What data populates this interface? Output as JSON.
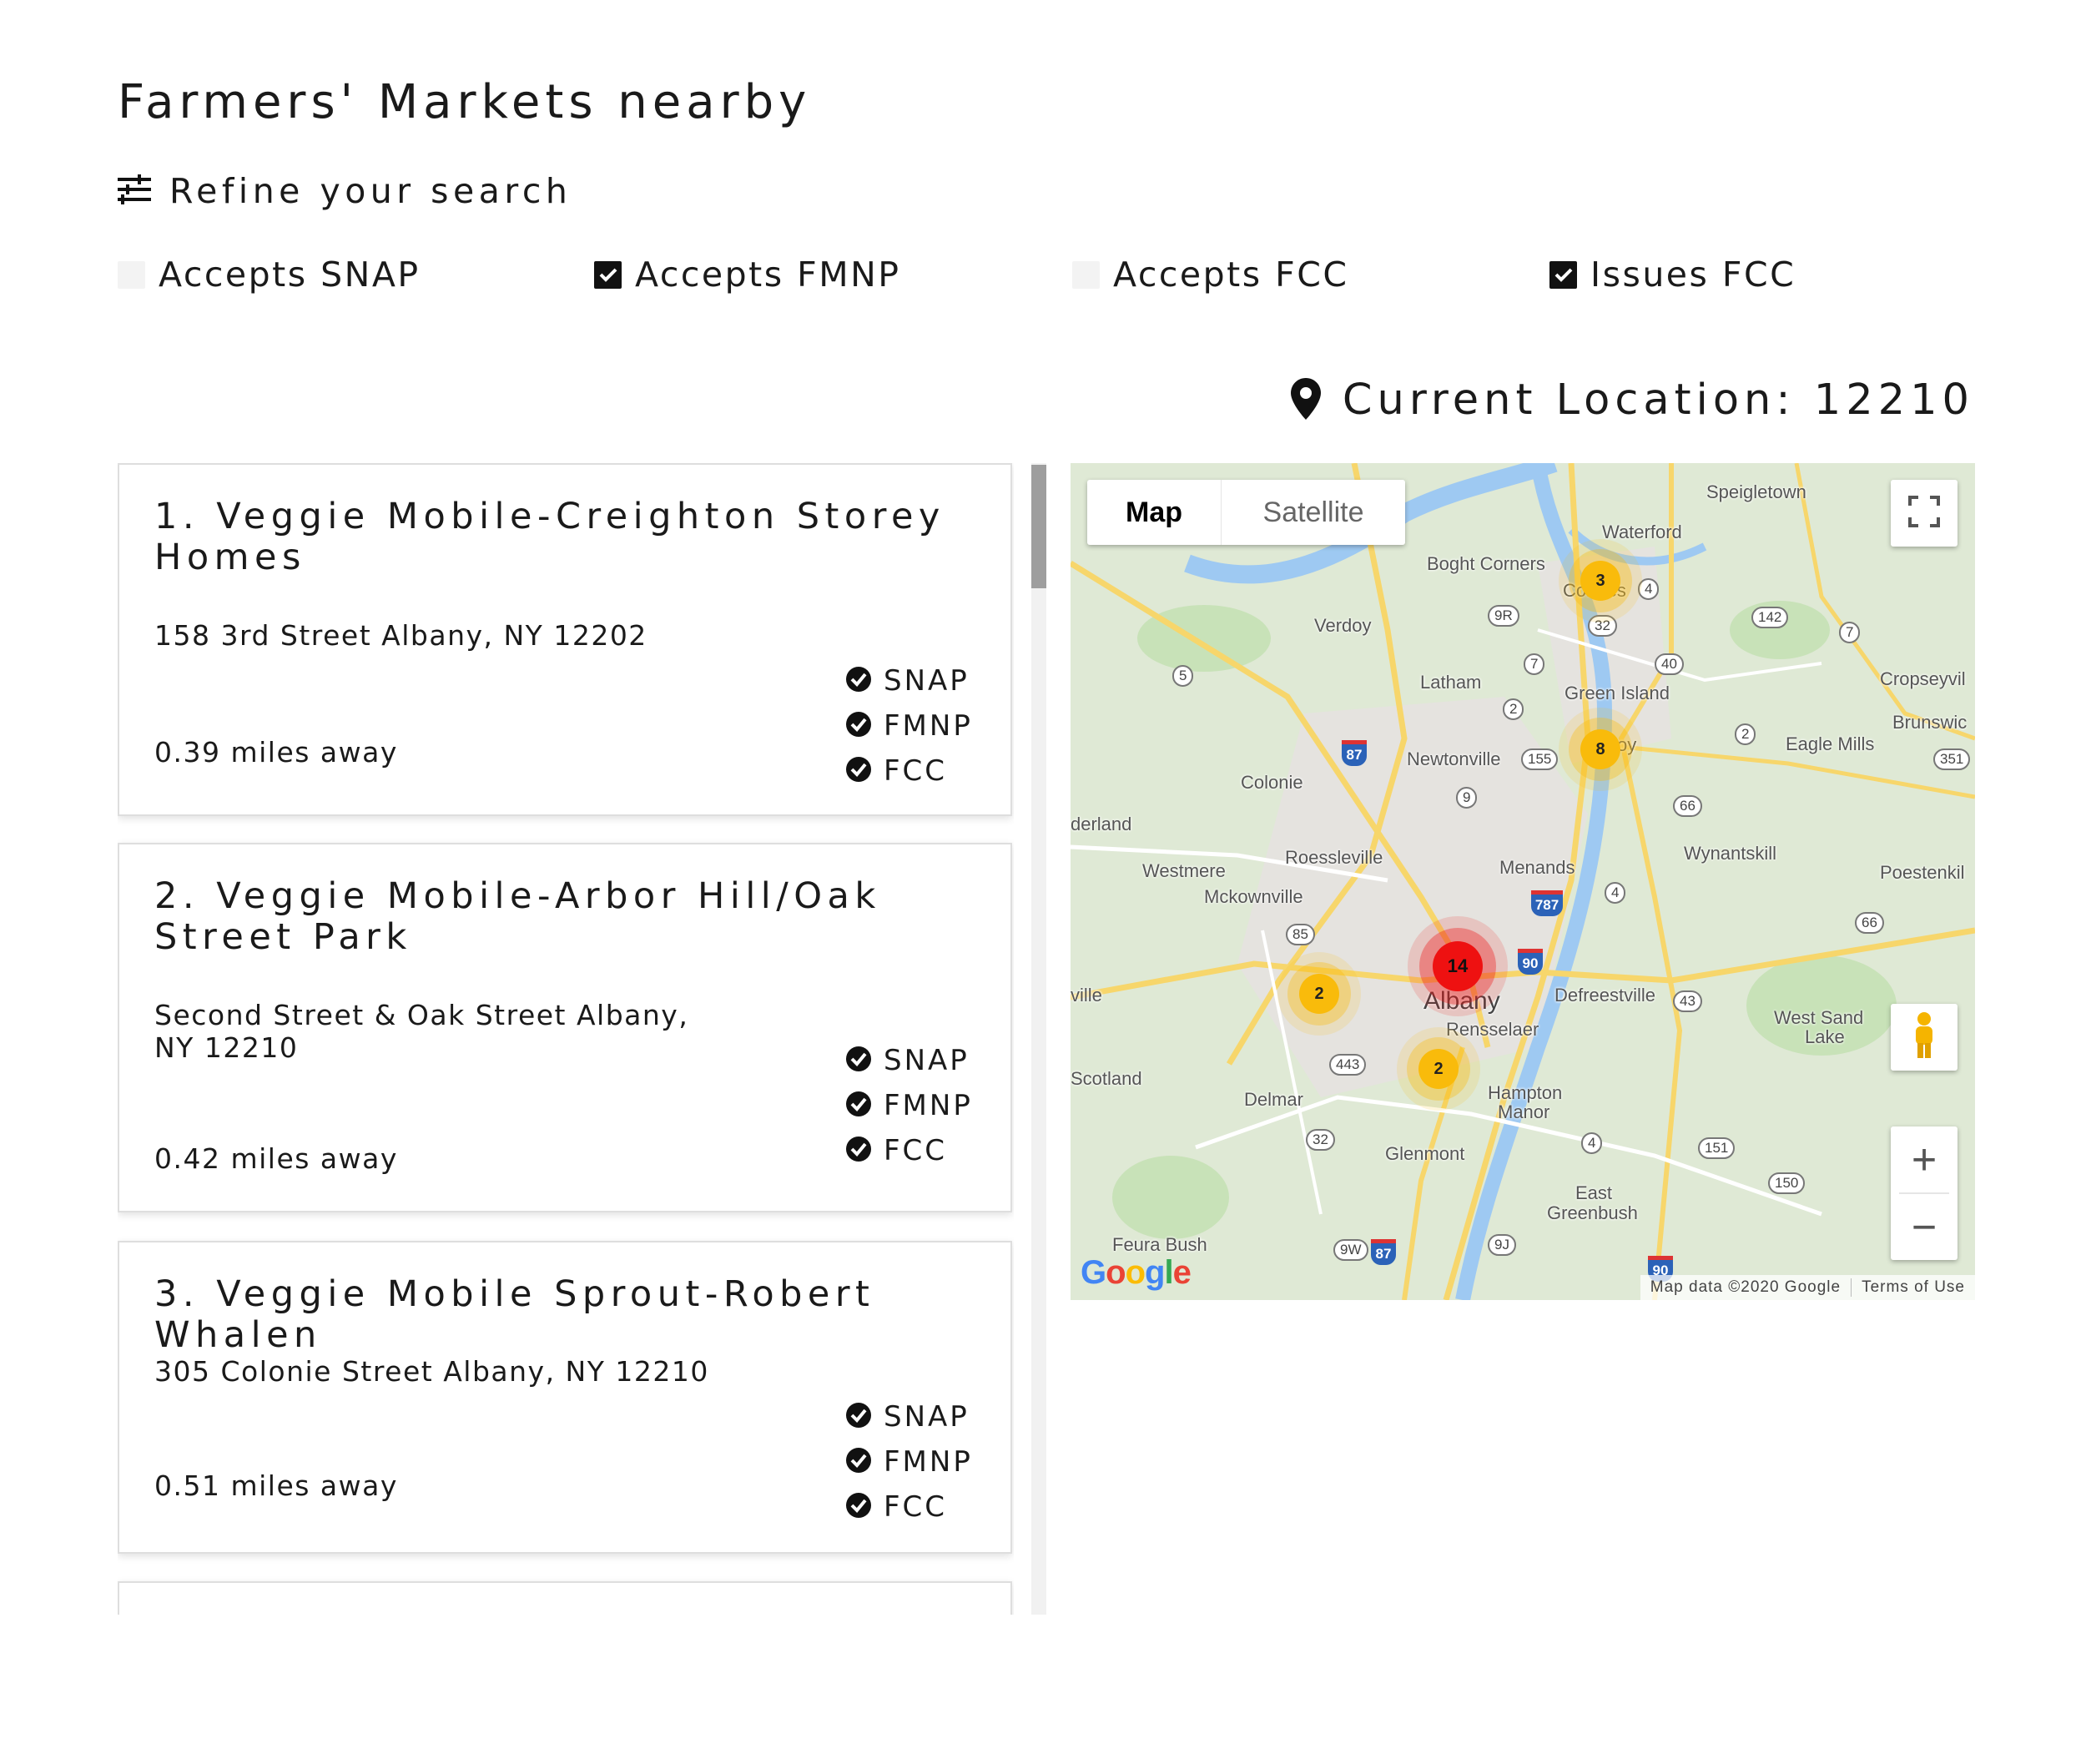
{
  "page": {
    "title": "Farmers' Markets nearby"
  },
  "refine": {
    "label": "Refine your search",
    "icon": "sliders-icon"
  },
  "filters": [
    {
      "label": "Accepts SNAP",
      "checked": false
    },
    {
      "label": "Accepts FMNP",
      "checked": true
    },
    {
      "label": "Accepts FCC",
      "checked": false
    },
    {
      "label": "Issues FCC",
      "checked": true
    }
  ],
  "location": {
    "label": "Current Location: 12210",
    "icon": "map-pin-icon"
  },
  "results": [
    {
      "name": "1. Veggie Mobile-Creighton Storey Homes",
      "address": "158 3rd Street Albany, NY 12202",
      "distance": "0.39 miles away",
      "badges": [
        "SNAP",
        "FMNP",
        "FCC"
      ]
    },
    {
      "name": "2. Veggie Mobile-Arbor Hill/Oak Street Park",
      "address": "Second Street & Oak Street Albany, NY 12210",
      "distance": "0.42 miles away",
      "badges": [
        "SNAP",
        "FMNP",
        "FCC"
      ]
    },
    {
      "name": "3. Veggie Mobile Sprout-Robert Whalen",
      "address": "305 Colonie Street Albany, NY 12210",
      "distance": "0.51 miles away",
      "badges": [
        "SNAP",
        "FMNP",
        "FCC"
      ]
    }
  ],
  "map": {
    "type_buttons": {
      "map": "Map",
      "satellite": "Satellite",
      "active": "Map"
    },
    "clusters": [
      {
        "count": "3",
        "color": "#f9bb0b"
      },
      {
        "count": "8",
        "color": "#f9bb0b"
      },
      {
        "count": "14",
        "color": "#ee1111"
      },
      {
        "count": "2",
        "color": "#f9bb0b"
      },
      {
        "count": "2",
        "color": "#f9bb0b"
      }
    ],
    "places": [
      "Speigletown",
      "Waterford",
      "Boght Corners",
      "Verdoy",
      "Latham",
      "Green Island",
      "Cropseyvil",
      "Brunswic",
      "Eagle Mills",
      "Newtonville",
      "Colonie",
      "derland",
      "Roessleville",
      "Westmere",
      "Mckownville",
      "Menands",
      "Wynantskill",
      "Poestenkil",
      "Albany",
      "Defreestville",
      "Rensselaer",
      "West Sand",
      "Lake",
      "ville",
      "Scotland",
      "Delmar",
      "Hampton",
      "Manor",
      "Glenmont",
      "East",
      "Greenbush",
      "Feura Bush",
      "Cohoes",
      "oy"
    ],
    "route_shields": [
      "5",
      "9R",
      "7",
      "4",
      "32",
      "142",
      "40",
      "2",
      "155",
      "9",
      "66",
      "351",
      "85",
      "443",
      "32",
      "151",
      "150",
      "9W",
      "9J",
      "43",
      "66",
      "4",
      "4",
      "7",
      "2"
    ],
    "interstates": [
      "87",
      "787",
      "90",
      "87",
      "90"
    ],
    "google_logo": "Google",
    "attribution": {
      "data": "Map data ©2020 Google",
      "terms": "Terms of Use"
    },
    "controls": {
      "zoom_in": "+",
      "zoom_out": "−",
      "fullscreen": "fullscreen-icon",
      "pegman": "pegman-icon"
    }
  },
  "colors": {
    "text": "#1a1a1a",
    "checkbox_on": "#111111",
    "checkbox_off": "#f3f3f3",
    "map_land": "#dfe9d5",
    "map_water": "#9ec9f2",
    "road_major": "#f7d66b",
    "cluster_yellow": "#f9bb0b",
    "cluster_red": "#ee1111"
  }
}
